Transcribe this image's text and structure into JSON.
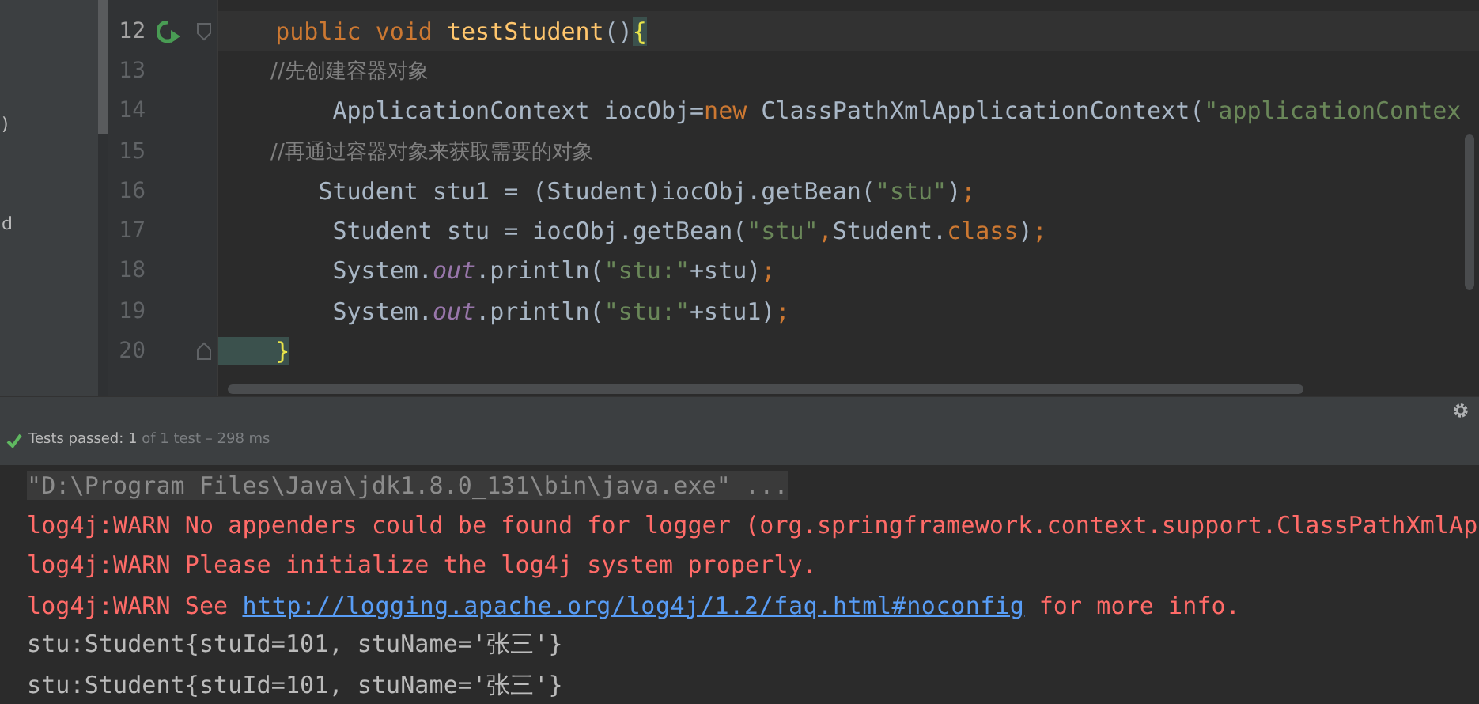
{
  "sidebar": {
    "fragments": [
      ")",
      "d"
    ]
  },
  "editor": {
    "lines": [
      {
        "number": "12",
        "run_icon": true,
        "fold": true,
        "current": true,
        "segments": [
          {
            "text": "    public void ",
            "kind": "keyword"
          },
          {
            "text": "testStudent",
            "kind": "method"
          },
          {
            "text": "()",
            "kind": "plain"
          },
          {
            "text": "{",
            "kind": "brace"
          }
        ]
      },
      {
        "number": "13",
        "run_icon": false,
        "fold": false,
        "current": false,
        "segments": [
          {
            "text": "        //先创建容器对象",
            "kind": "comment"
          }
        ]
      },
      {
        "number": "14",
        "run_icon": false,
        "fold": false,
        "current": false,
        "segments": [
          {
            "text": "        ApplicationContext iocObj=",
            "kind": "plain"
          },
          {
            "text": "new ",
            "kind": "keyword"
          },
          {
            "text": "ClassPathXmlApplicationContext(",
            "kind": "plain"
          },
          {
            "text": "\"applicationContex",
            "kind": "string"
          }
        ]
      },
      {
        "number": "15",
        "run_icon": false,
        "fold": false,
        "current": false,
        "segments": [
          {
            "text": "        //再通过容器对象来获取需要的对象",
            "kind": "comment"
          }
        ]
      },
      {
        "number": "16",
        "run_icon": false,
        "fold": false,
        "current": false,
        "segments": [
          {
            "text": "       Student stu1 = (Student)iocObj.getBean(",
            "kind": "plain"
          },
          {
            "text": "\"stu\"",
            "kind": "string"
          },
          {
            "text": ")",
            "kind": "plain"
          },
          {
            "text": ";",
            "kind": "keyword"
          }
        ]
      },
      {
        "number": "17",
        "run_icon": false,
        "fold": false,
        "current": false,
        "segments": [
          {
            "text": "        Student stu = iocObj.getBean(",
            "kind": "plain"
          },
          {
            "text": "\"stu\"",
            "kind": "string"
          },
          {
            "text": ",",
            "kind": "keyword"
          },
          {
            "text": "Student.",
            "kind": "plain"
          },
          {
            "text": "class",
            "kind": "keyword"
          },
          {
            "text": ")",
            "kind": "plain"
          },
          {
            "text": ";",
            "kind": "keyword"
          }
        ]
      },
      {
        "number": "18",
        "run_icon": false,
        "fold": false,
        "current": false,
        "segments": [
          {
            "text": "        System.",
            "kind": "plain"
          },
          {
            "text": "out",
            "kind": "static"
          },
          {
            "text": ".println(",
            "kind": "plain"
          },
          {
            "text": "\"stu:\"",
            "kind": "string"
          },
          {
            "text": "+stu)",
            "kind": "plain"
          },
          {
            "text": ";",
            "kind": "keyword"
          }
        ]
      },
      {
        "number": "19",
        "run_icon": false,
        "fold": false,
        "current": false,
        "segments": [
          {
            "text": "        System.",
            "kind": "plain"
          },
          {
            "text": "out",
            "kind": "static"
          },
          {
            "text": ".println(",
            "kind": "plain"
          },
          {
            "text": "\"stu:\"",
            "kind": "string"
          },
          {
            "text": "+stu1)",
            "kind": "plain"
          },
          {
            "text": ";",
            "kind": "keyword"
          }
        ]
      },
      {
        "number": "20",
        "run_icon": false,
        "fold": true,
        "current": false,
        "segments": [
          {
            "text": "    }",
            "kind": "brace"
          }
        ]
      }
    ]
  },
  "test_status": "**Tests passed: 1** of 1 test – 298 ms",
  "console": {
    "lines": [
      {
        "kind": "command",
        "segments": [
          {
            "text": "\"D:\\Program Files\\Java\\jdk1.8.0_131\\bin\\java.exe\" ...",
            "kind": "text"
          }
        ]
      },
      {
        "kind": "error",
        "segments": [
          {
            "text": "log4j:WARN No appenders could be found for logger (org.springframework.context.support.ClassPathXmlAp",
            "kind": "text"
          }
        ]
      },
      {
        "kind": "error",
        "segments": [
          {
            "text": "log4j:WARN Please initialize the log4j system properly.",
            "kind": "text"
          }
        ]
      },
      {
        "kind": "error",
        "segments": [
          {
            "text": "log4j:WARN See ",
            "kind": "text"
          },
          {
            "text": "http://logging.apache.org/log4j/1.2/faq.html#noconfig",
            "kind": "link"
          },
          {
            "text": " for more info.",
            "kind": "text"
          }
        ]
      },
      {
        "kind": "output",
        "segments": [
          {
            "text": "stu:Student{stuId=101, stuName='张三'}",
            "kind": "text"
          }
        ]
      },
      {
        "kind": "output",
        "segments": [
          {
            "text": "stu:Student{stuId=101, stuName='张三'}",
            "kind": "text"
          }
        ]
      }
    ]
  }
}
